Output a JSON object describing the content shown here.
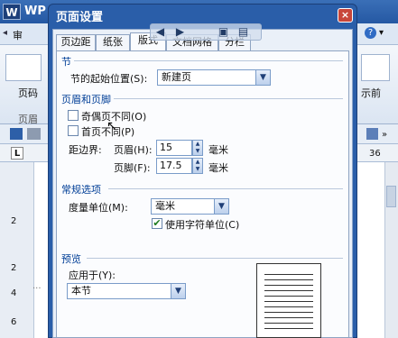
{
  "app": {
    "logo": "W",
    "name": "WP",
    "menu_left": "审",
    "ribbon_left_label": "页码",
    "ribbon_left_label2": "页眉",
    "ribbon_right_label": "示前",
    "ruler_corner": "L",
    "ruler_right_value": "36",
    "left_ruler_numbers": [
      "2",
      "2",
      "4",
      "6"
    ],
    "page_mark": "..."
  },
  "dialog": {
    "title": "页面设置",
    "close_label": "×",
    "tabs": [
      {
        "label": "页边距"
      },
      {
        "label": "纸张"
      },
      {
        "label": "版式"
      },
      {
        "label": "文档网格"
      },
      {
        "label": "分栏"
      }
    ],
    "section": {
      "title": "节",
      "start_label": "节的起始位置(S):",
      "start_value": "新建页"
    },
    "header_footer": {
      "title": "页眉和页脚",
      "odd_even_label": "奇偶页不同(O)",
      "odd_even_checked": false,
      "first_page_label": "首页不同(P)",
      "first_page_checked": false,
      "from_edge_label": "距边界:",
      "header_label": "页眉(H):",
      "header_value": "15",
      "footer_label": "页脚(F):",
      "footer_value": "17.5",
      "unit": "毫米"
    },
    "general": {
      "title": "常规选项",
      "unit_label": "度量单位(M):",
      "unit_value": "毫米",
      "char_unit_label": "使用字符单位(C)",
      "char_unit_checked": true
    },
    "preview": {
      "title": "预览",
      "apply_label": "应用于(Y):",
      "apply_value": "本节"
    }
  },
  "icons": {
    "float_toolbar": [
      "left-arrow-icon",
      "right-arrow-icon",
      "save-icon",
      "print-icon"
    ]
  }
}
